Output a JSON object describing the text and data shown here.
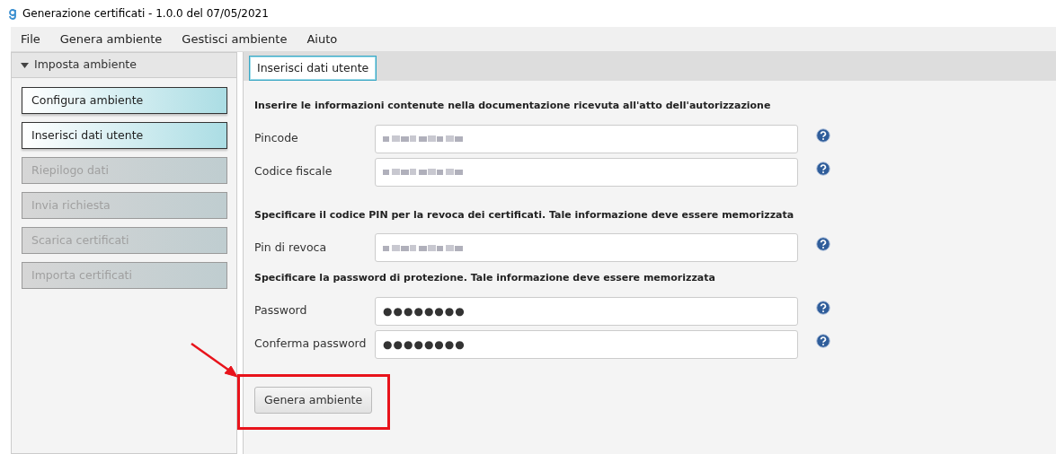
{
  "window": {
    "title": "Generazione certificati - 1.0.0 del 07/05/2021"
  },
  "menu": [
    "File",
    "Genera ambiente",
    "Gestisci ambiente",
    "Aiuto"
  ],
  "sidebar": {
    "title": "Imposta ambiente",
    "expanded": true,
    "items": [
      {
        "label": "Configura ambiente",
        "disabled": false
      },
      {
        "label": "Inserisci dati utente",
        "disabled": false
      },
      {
        "label": "Riepilogo dati",
        "disabled": true
      },
      {
        "label": "Invia richiesta",
        "disabled": true
      },
      {
        "label": "Scarica certificati",
        "disabled": true
      },
      {
        "label": "Importa certificati",
        "disabled": true
      }
    ]
  },
  "tabs": [
    {
      "label": "Inserisci dati utente",
      "selected": true
    }
  ],
  "form": [
    {
      "kind": "heading",
      "text": "Inserire le informazioni contenute nella documentazione ricevuta all'atto dell'autorizzazione"
    },
    {
      "kind": "field",
      "label": "Pincode",
      "blurred": true
    },
    {
      "kind": "field",
      "label": "Codice fiscale",
      "blurred": true
    },
    {
      "kind": "heading",
      "text": "Specificare il codice PIN per la revoca dei certificati. Tale informazione deve essere memorizzata"
    },
    {
      "kind": "field",
      "label": "Pin di revoca",
      "blurred": true
    },
    {
      "kind": "heading",
      "text": "Specificare la password di protezione. Tale informazione deve essere memorizzata"
    },
    {
      "kind": "field",
      "label": "Password",
      "blurred": false,
      "value": "●●●●●●●●"
    },
    {
      "kind": "field",
      "label": "Conferma password",
      "blurred": false,
      "value": "●●●●●●●●"
    }
  ],
  "button": {
    "label": "Genera ambiente"
  }
}
